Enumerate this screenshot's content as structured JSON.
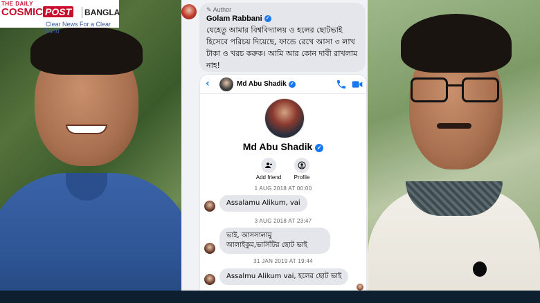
{
  "logo": {
    "top_line": "THE DAILY",
    "cosmic": "COSMIC",
    "post": "POST",
    "bangla": "BANGLA",
    "tagline": "Clear News For a Clear Mind",
    "brand_color": "#c8102e"
  },
  "comment": {
    "author_tag": "Author",
    "author_name": "Golam Rabbani",
    "text": "যেহেতু আমার বিশ্ববিদ্যালয় ও হলের ছোটভাই হিসেবে পরিচয় দিয়েছে, ফান্ডে রেখে আসা ৩ লাখ টাকা ও খরচ করুক। আমি আর কোন দাবী রাখলাম নাহ!"
  },
  "messenger": {
    "header_name": "Md Abu Shadik",
    "profile_name": "Md Abu Shadik",
    "actions": [
      {
        "label": "Add friend",
        "icon": "add-friend-icon"
      },
      {
        "label": "Profile",
        "icon": "profile-icon"
      }
    ],
    "accent_color": "#1877f2",
    "messages": [
      {
        "timestamp": "1 AUG 2018 AT 00:00",
        "text": "Assalamu Alikum, vai"
      },
      {
        "timestamp": "3 AUG 2018 AT 23:47",
        "text": "ভাই, আসসালামু আলাইকুম,ভার্সিটির ছোট ভাই"
      },
      {
        "timestamp": "31 JAN 2019 AT 19:44",
        "text": "Assalmu Alikum vai, হলের ছোট ভাই"
      }
    ]
  }
}
